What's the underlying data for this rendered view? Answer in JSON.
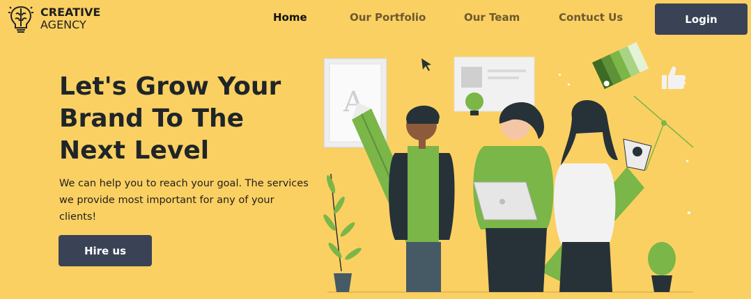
{
  "brand": {
    "line1": "CREATIVE",
    "line2": "AGENCY",
    "icon": "brain-bulb-icon"
  },
  "nav": {
    "items": [
      {
        "label": "Home",
        "active": true
      },
      {
        "label": "Our Portfolio",
        "active": false
      },
      {
        "label": "Our Team",
        "active": false
      },
      {
        "label": "Contuct Us",
        "active": false
      }
    ],
    "login_label": "Login"
  },
  "hero": {
    "headline": [
      "Let's Grow Your",
      "Brand To The",
      "Next Level"
    ],
    "subtitle": "We can help you to reach your goal. The services we provide most important for any of your clients!",
    "cta_label": "Hire us",
    "illustration_letter": "A"
  },
  "colors": {
    "background": "#FBD062",
    "button": "#3A4256",
    "accent_green": "#7AB648",
    "dark": "#263238"
  }
}
